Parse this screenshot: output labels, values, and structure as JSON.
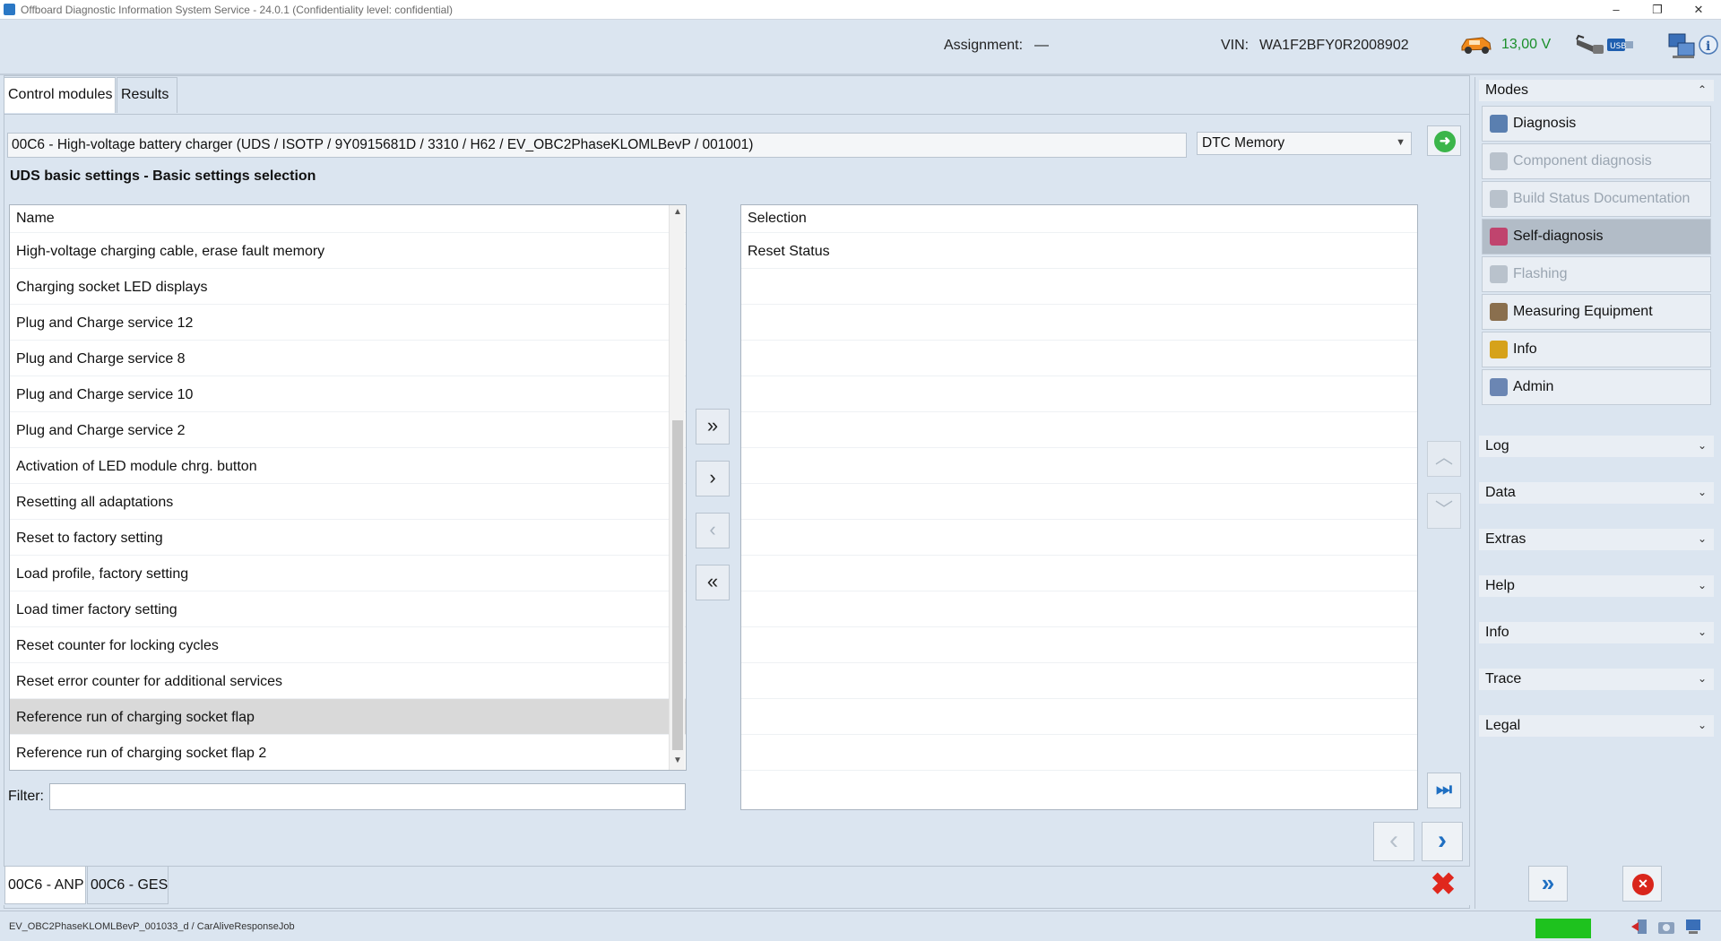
{
  "window": {
    "title": "Offboard Diagnostic Information System Service - 24.0.1 (Confidentiality level: confidential)",
    "minimize": "–",
    "restore": "❐",
    "close": "✕"
  },
  "header": {
    "assignment_label": "Assignment:",
    "assignment_value": "—",
    "vin_label": "VIN:",
    "vin_value": "WA1F2BFY0R2008902",
    "voltage": "13,00 V",
    "icons": [
      "car-icon",
      "diagnostic-interface-icon",
      "usb-icon",
      "network-icon",
      "info-icon"
    ]
  },
  "tabs": [
    {
      "label": "Control modules",
      "active": true
    },
    {
      "label": "Results",
      "active": false
    }
  ],
  "module_path": "00C6 - High-voltage battery charger  (UDS / ISOTP / 9Y0915681D / 3310 / H62 / EV_OBC2PhaseKLOMLBevP / 001001)",
  "function_select": {
    "value": "DTC Memory"
  },
  "section_title": "UDS basic settings - Basic settings selection",
  "name_list": {
    "header": "Name",
    "items": [
      "High-voltage charging cable, erase fault memory",
      "Charging socket LED displays",
      "Plug and Charge service 12",
      "Plug and Charge service 8",
      "Plug and Charge service 10",
      "Plug and Charge service 2",
      "Activation of LED module chrg. button",
      "Resetting all adaptations",
      "Reset to factory setting",
      "Load profile, factory setting",
      "Load timer factory setting",
      "Reset counter for locking cycles",
      "Reset error counter for additional services",
      "Reference run of charging socket flap",
      "Reference run of charging socket flap 2"
    ],
    "selected_index": 13
  },
  "selection_list": {
    "header": "Selection",
    "items": [
      "Reset Status"
    ]
  },
  "move_buttons": {
    "add_all": "»",
    "add": "›",
    "remove": "‹",
    "remove_all": "«"
  },
  "filter": {
    "label": "Filter:",
    "value": ""
  },
  "bottom_tabs": [
    {
      "label": "00C6 - ANP",
      "active": true
    },
    {
      "label": "00C6 - GES",
      "active": false
    }
  ],
  "sidebar": {
    "modes_label": "Modes",
    "modes": [
      {
        "label": "Diagnosis",
        "state": "normal",
        "icon": "stethoscope-icon",
        "color": "#5a7fb0"
      },
      {
        "label": "Component diagnosis",
        "state": "disabled",
        "icon": "component-diagnosis-icon",
        "color": "#b9c2cc"
      },
      {
        "label": "Build Status Documentation",
        "state": "disabled",
        "icon": "build-status-icon",
        "color": "#b9c2cc"
      },
      {
        "label": "Self-diagnosis",
        "state": "active",
        "icon": "self-diagnosis-icon",
        "color": "#c0446e"
      },
      {
        "label": "Flashing",
        "state": "disabled",
        "icon": "flashing-icon",
        "color": "#b9c2cc"
      },
      {
        "label": "Measuring Equipment",
        "state": "normal",
        "icon": "gauge-icon",
        "color": "#8a6f4e"
      },
      {
        "label": "Info",
        "state": "normal",
        "icon": "books-icon",
        "color": "#d6a21a"
      },
      {
        "label": "Admin",
        "state": "normal",
        "icon": "admin-gear-icon",
        "color": "#6b86b3"
      }
    ],
    "sections": [
      "Log",
      "Data",
      "Extras",
      "Help",
      "Info",
      "Trace",
      "Legal"
    ]
  },
  "status": {
    "job_text": "EV_OBC2PhaseKLOMLBevP_001033_d / CarAliveResponseJob",
    "indicator_color": "#1ec21e"
  },
  "colors": {
    "background": "#dbe5f0",
    "accent_blue": "#1f6fc2",
    "go_green": "#3bb54a",
    "cancel_red": "#e0271d"
  }
}
